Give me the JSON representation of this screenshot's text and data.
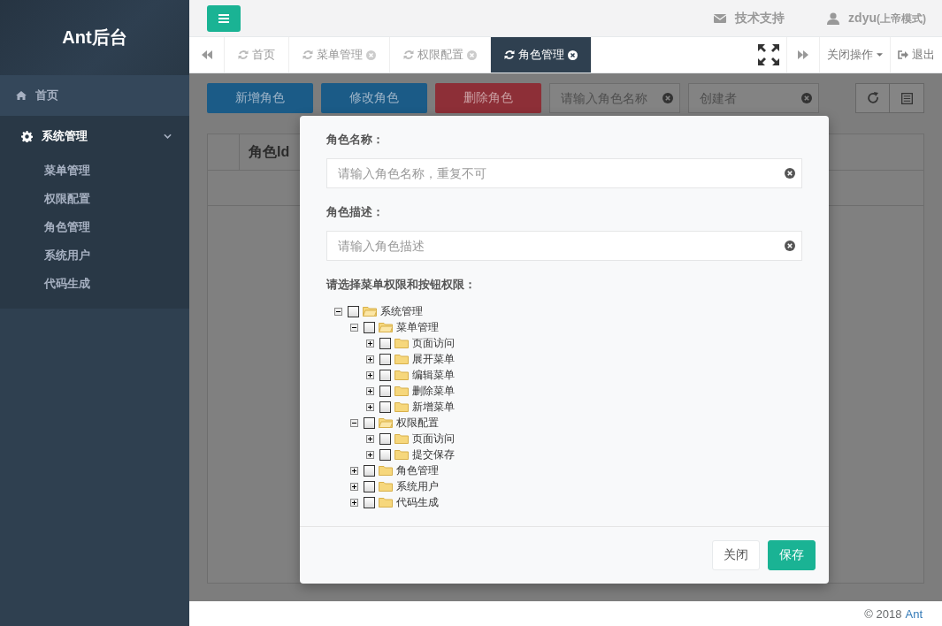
{
  "sidebar": {
    "logo": "Ant后台",
    "items": [
      {
        "label": "首页",
        "kind": "link",
        "selected": true
      },
      {
        "label": "系统管理",
        "kind": "group",
        "selected": false,
        "expanded": true,
        "children": [
          {
            "label": "菜单管理",
            "selected": false
          },
          {
            "label": "权限配置",
            "selected": false
          },
          {
            "label": "角色管理",
            "selected": false
          },
          {
            "label": "系统用户",
            "selected": false
          },
          {
            "label": "代码生成",
            "selected": false
          }
        ]
      }
    ]
  },
  "header": {
    "support": "技术支持",
    "user": "zdyu",
    "user_role": "(上帝模式)"
  },
  "tabs": [
    {
      "label": "首页",
      "closable": false,
      "selected": false
    },
    {
      "label": "菜单管理",
      "closable": true,
      "selected": false
    },
    {
      "label": "权限配置",
      "closable": true,
      "selected": false
    },
    {
      "label": "角色管理",
      "closable": true,
      "selected": true
    }
  ],
  "tab_actions": {
    "close_menu": "关闭操作",
    "logout": "退出"
  },
  "toolbar": {
    "buttons": [
      {
        "label": "新增角色",
        "kind": "primary"
      },
      {
        "label": "修改角色",
        "kind": "primary"
      },
      {
        "label": "删除角色",
        "kind": "danger"
      }
    ],
    "search_fields": [
      {
        "placeholder": "请输入角色名称"
      },
      {
        "placeholder": "创建者"
      }
    ]
  },
  "table": {
    "columns": [
      "角色Id"
    ]
  },
  "modal": {
    "fields": [
      {
        "label": "角色名称：",
        "placeholder": "请输入角色名称，重复不可"
      },
      {
        "label": "角色描述：",
        "placeholder": "请输入角色描述"
      }
    ],
    "tree_label": "请选择菜单权限和按钮权限：",
    "tree": [
      {
        "label": "系统管理",
        "checked": false,
        "expanded": true,
        "children": [
          {
            "label": "菜单管理",
            "checked": false,
            "expanded": true,
            "children": [
              {
                "label": "页面访问",
                "checked": false,
                "expanded": false
              },
              {
                "label": "展开菜单",
                "checked": false,
                "expanded": false
              },
              {
                "label": "编辑菜单",
                "checked": false,
                "expanded": false
              },
              {
                "label": "删除菜单",
                "checked": false,
                "expanded": false
              },
              {
                "label": "新增菜单",
                "checked": false,
                "expanded": false
              }
            ]
          },
          {
            "label": "权限配置",
            "checked": false,
            "expanded": true,
            "children": [
              {
                "label": "页面访问",
                "checked": false,
                "expanded": false
              },
              {
                "label": "提交保存",
                "checked": false,
                "expanded": false
              }
            ]
          },
          {
            "label": "角色管理",
            "checked": false,
            "expanded": false
          },
          {
            "label": "系统用户",
            "checked": false,
            "expanded": false
          },
          {
            "label": "代码生成",
            "checked": false,
            "expanded": false
          }
        ]
      }
    ],
    "buttons": [
      {
        "label": "关闭",
        "kind": "default"
      },
      {
        "label": "保存",
        "kind": "primary"
      }
    ]
  },
  "footer": {
    "copyright": "© 2018",
    "link": "Ant"
  }
}
